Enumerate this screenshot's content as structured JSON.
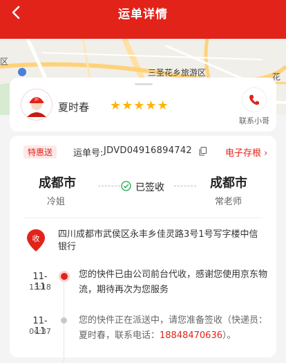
{
  "header": {
    "title": "运单详情"
  },
  "map": {
    "labels": [
      "三圣花乡旅游区",
      "区",
      "花"
    ]
  },
  "courier": {
    "name": "夏时春",
    "rating": 5,
    "stars": "★★★★★",
    "contact_label": "联系小哥"
  },
  "waybill": {
    "badge": "特惠送",
    "number_label": "运单号:",
    "number": "JDVD04916894742",
    "receipt_link": "电子存根 ›",
    "from_city": "成都市",
    "from_person": "冷姐",
    "status": "已签收",
    "to_city": "成都市",
    "to_person": "常老师"
  },
  "address": {
    "pin_label": "收",
    "text": "四川成都市武侯区永丰乡佳灵路3号1号写字楼中信银行"
  },
  "timeline": [
    {
      "date": "11-11",
      "time": "13:18",
      "text": "您的快件已由公司前台代收，感谢您使用京东物流，期待再次为您服务"
    },
    {
      "date": "11-11",
      "time": "04:37",
      "text_before": "您的快件正在派送中，请您准备签收（快递员：夏时春，联系电话：",
      "phone": "18848470636",
      "text_after": "）。"
    }
  ],
  "colors": {
    "brand": "#e2231a",
    "star": "#ffb400"
  }
}
